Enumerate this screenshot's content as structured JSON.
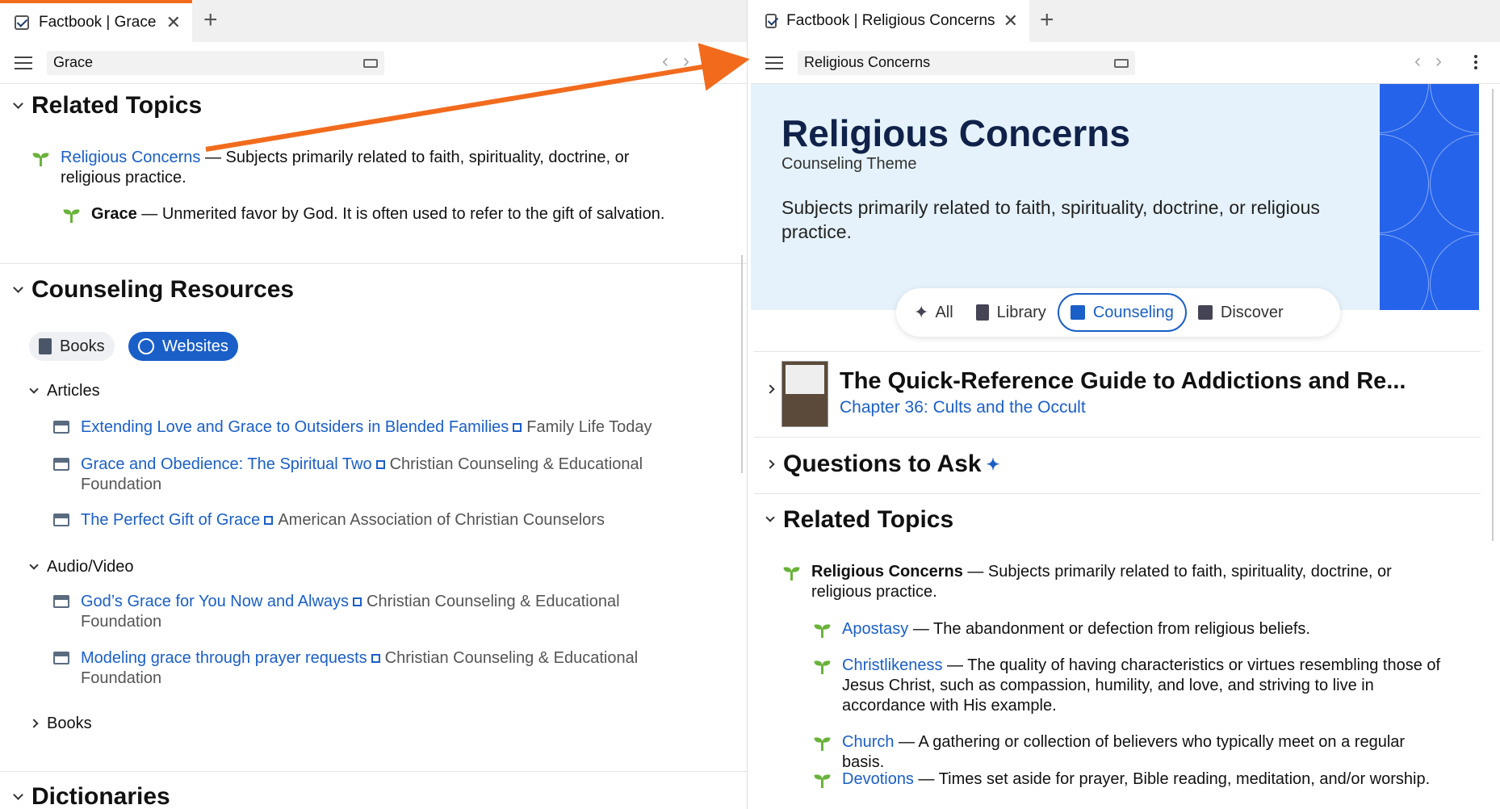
{
  "left": {
    "tab": {
      "title": "Factbook | Grace"
    },
    "search": {
      "value": "Grace"
    },
    "related": {
      "heading": "Related Topics",
      "parent": {
        "title": "Religious Concerns",
        "desc": "— Subjects primarily related to faith, spirituality, doctrine, or religious practice."
      },
      "child": {
        "title": "Grace",
        "desc": "— Unmerited favor by God. It is often used to refer to the gift of salvation."
      }
    },
    "counseling": {
      "heading": "Counseling Resources",
      "filters": [
        "Books",
        "Websites"
      ],
      "articles_heading": "Articles",
      "articles": [
        {
          "title": "Extending Love and Grace to Outsiders in Blended Families",
          "source": "Family Life Today"
        },
        {
          "title": "Grace and Obedience: The Spiritual Two",
          "source": "Christian Counseling & Educational Foundation"
        },
        {
          "title": "The Perfect Gift of Grace",
          "source": "American Association of Christian Counselors"
        }
      ],
      "av_heading": "Audio/Video",
      "av": [
        {
          "title": "God’s Grace for You Now and Always",
          "source": "Christian Counseling & Educational Foundation"
        },
        {
          "title": "Modeling grace through prayer requests",
          "source": "Christian Counseling & Educational Foundation"
        }
      ],
      "books_heading": "Books"
    },
    "dictionaries_heading": "Dictionaries"
  },
  "right": {
    "tab": {
      "title": "Factbook | Religious Concerns"
    },
    "search": {
      "value": "Religious Concerns"
    },
    "banner": {
      "title": "Religious Concerns",
      "subtitle": "Counseling Theme",
      "desc": "Subjects primarily related to faith, spirituality, doctrine, or religious practice."
    },
    "filters": {
      "all": "All",
      "library": "Library",
      "counseling": "Counseling",
      "discover": "Discover",
      "active": "Counseling"
    },
    "book": {
      "title": "The Quick-Reference Guide to Addictions and Re...",
      "chapter": "Chapter 36: Cults and the Occult"
    },
    "questions_heading": "Questions to Ask",
    "related": {
      "heading": "Related Topics",
      "parent": {
        "title": "Religious Concerns",
        "desc": "— Subjects primarily related to faith, spirituality, doctrine, or religious practice."
      },
      "children": [
        {
          "title": "Apostasy",
          "desc": "— The abandonment or defection from religious beliefs."
        },
        {
          "title": "Christlikeness",
          "desc": "— The quality of having characteristics or virtues resembling those of Jesus Christ, such as compassion, humility, and love, and striving to live in accordance with His example."
        },
        {
          "title": "Church",
          "desc": "— A gathering or collection of believers who typically meet on a regular basis."
        },
        {
          "title": "Devotions",
          "desc": "— Times set aside for prayer, Bible reading, meditation, and/or worship."
        }
      ]
    }
  },
  "colors": {
    "accent": "#1a5fc8",
    "arrow": "#f26b1d",
    "banner_bg": "#e5f2fb",
    "banner_pattern": "#2563eb",
    "sprout": "#6ab33a"
  }
}
